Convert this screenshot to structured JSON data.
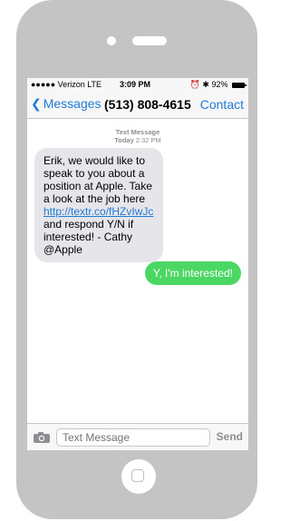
{
  "status_bar": {
    "carrier": "●●●●● Verizon  LTE",
    "time": "3:09 PM",
    "battery": "92%"
  },
  "nav": {
    "back_label": "Messages",
    "title": "(513) 808-4615",
    "contact_label": "Contact"
  },
  "thread": {
    "meta_label": "Text Message",
    "meta_day": "Today",
    "meta_time": "2:32 PM",
    "incoming_text_before": "Erik, we would like to speak to you about a position at Apple. Take a look at the job here ",
    "incoming_link": "http://textr.co/fHZvIwJc",
    "incoming_text_after": " and respond Y/N if interested! - Cathy @Apple",
    "outgoing_text": "Y, I'm interested!"
  },
  "input": {
    "placeholder": "Text Message",
    "send_label": "Send"
  },
  "colors": {
    "accent": "#1f7bd6",
    "incoming_bubble": "#e5e5ea",
    "outgoing_bubble": "#4bd763",
    "phone_body": "#c4c4c4"
  }
}
